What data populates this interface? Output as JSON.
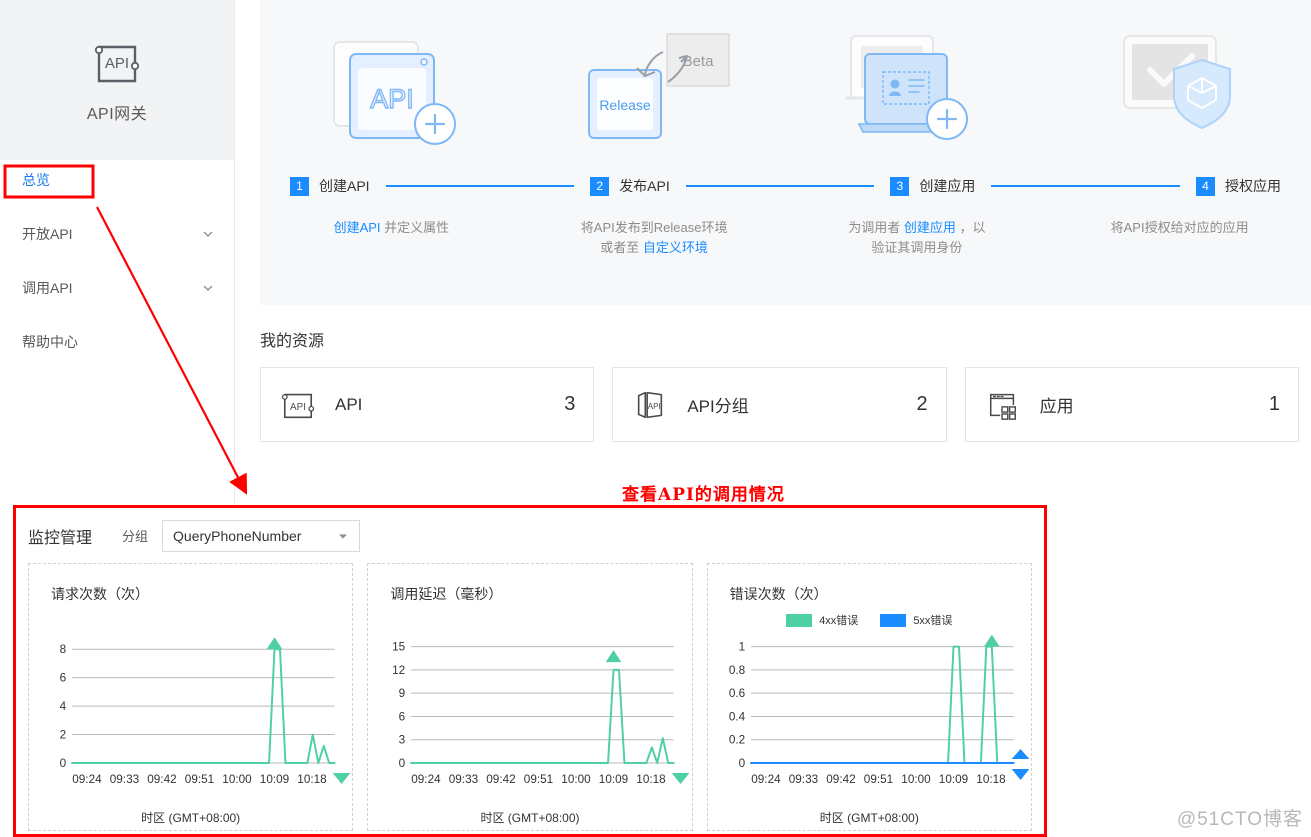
{
  "sidebar": {
    "logo": {
      "icon": "api-gateway-icon",
      "label": "API网关"
    },
    "items": [
      {
        "label": "总览",
        "active": true,
        "expandable": false
      },
      {
        "label": "开放API",
        "active": false,
        "expandable": true
      },
      {
        "label": "调用API",
        "active": false,
        "expandable": true
      },
      {
        "label": "帮助中心",
        "active": false,
        "expandable": false
      }
    ]
  },
  "workflow": {
    "illustrations": [
      "api-create-illustration",
      "release-beta-illustration",
      "app-create-illustration",
      "authorize-shield-illustration"
    ],
    "beta_label": "Beta",
    "release_label": "Release",
    "api_label": "API",
    "steps": [
      {
        "num": "1",
        "label": "创建API"
      },
      {
        "num": "2",
        "label": "发布API"
      },
      {
        "num": "3",
        "label": "创建应用"
      },
      {
        "num": "4",
        "label": "授权应用"
      }
    ],
    "descriptions": [
      {
        "parts": [
          {
            "t": "创建API",
            "link": true
          },
          {
            "t": " 并定义属性",
            "link": false
          }
        ]
      },
      {
        "parts": [
          {
            "t": "将API发布到Release环境",
            "link": false
          },
          {
            "t": "\n",
            "link": false
          },
          {
            "t": "或者至 ",
            "link": false
          },
          {
            "t": "自定义环境",
            "link": true
          }
        ]
      },
      {
        "parts": [
          {
            "t": "为调用者 ",
            "link": false
          },
          {
            "t": "创建应用",
            "link": true
          },
          {
            "t": " ，以",
            "link": false
          },
          {
            "t": "\n",
            "link": false
          },
          {
            "t": "验证其调用身份",
            "link": false
          }
        ]
      },
      {
        "parts": [
          {
            "t": "将API授权给对应的应用",
            "link": false
          }
        ]
      }
    ]
  },
  "resources": {
    "title": "我的资源",
    "cards": [
      {
        "icon": "api-icon",
        "name": "API",
        "count": "3"
      },
      {
        "icon": "api-group-icon",
        "name": "API分组",
        "count": "2"
      },
      {
        "icon": "application-icon",
        "name": "应用",
        "count": "1"
      }
    ]
  },
  "monitor": {
    "title": "监控管理",
    "group_label": "分组",
    "group_selected": "QueryPhoneNumber",
    "timezone_label": "时区 (GMT+08:00)",
    "colors": {
      "series_green": "#4ecfa4",
      "series_blue": "#1a8cff",
      "accent": "#1a8cff",
      "annotation_red": "#ff0000"
    }
  },
  "annotation": {
    "callout_text": "查看API的调用情况",
    "highlight_target": "总览",
    "watermark": "@51CTO博客"
  },
  "chart_data": [
    {
      "type": "line",
      "title": "请求次数（次）",
      "xlabel": "时区 (GMT+08:00)",
      "ylabel": "",
      "ylim": [
        0,
        9
      ],
      "yticks": [
        0,
        2,
        4,
        6,
        8
      ],
      "grid": true,
      "x_ticklabels": [
        "09:24",
        "09:33",
        "09:42",
        "09:51",
        "10:00",
        "10:09",
        "10:18"
      ],
      "series": [
        {
          "name": "请求次数",
          "color": "#4ecfa4",
          "x": [
            0,
            1,
            2,
            3,
            4,
            5,
            6,
            7,
            8,
            9,
            10,
            11,
            12,
            13,
            14,
            15,
            16,
            17,
            18,
            19,
            20,
            21,
            22,
            23,
            24,
            25,
            26,
            27,
            28,
            29,
            30,
            31,
            32,
            33,
            34,
            35,
            36,
            37,
            38,
            39,
            40,
            41,
            42,
            43,
            44,
            45,
            46,
            47,
            48
          ],
          "values": [
            0,
            0,
            0,
            0,
            0,
            0,
            0,
            0,
            0,
            0,
            0,
            0,
            0,
            0,
            0,
            0,
            0,
            0,
            0,
            0,
            0,
            0,
            0,
            0,
            0,
            0,
            0,
            0,
            0,
            0,
            0,
            0,
            0,
            0,
            0,
            0,
            0,
            8,
            8,
            0,
            0,
            0,
            0,
            0,
            2,
            0,
            1.2,
            0,
            0
          ]
        }
      ],
      "marker": {
        "type": "triangle-up",
        "color": "#4ecfa4",
        "at_x_index": 37,
        "at_y": 8
      }
    },
    {
      "type": "line",
      "title": "调用延迟（毫秒）",
      "xlabel": "时区 (GMT+08:00)",
      "ylabel": "",
      "ylim": [
        0,
        16.5
      ],
      "yticks": [
        0,
        3,
        6,
        9,
        12,
        15
      ],
      "grid": true,
      "x_ticklabels": [
        "09:24",
        "09:33",
        "09:42",
        "09:51",
        "10:00",
        "10:09",
        "10:18"
      ],
      "series": [
        {
          "name": "调用延迟",
          "color": "#4ecfa4",
          "x": [
            0,
            1,
            2,
            3,
            4,
            5,
            6,
            7,
            8,
            9,
            10,
            11,
            12,
            13,
            14,
            15,
            16,
            17,
            18,
            19,
            20,
            21,
            22,
            23,
            24,
            25,
            26,
            27,
            28,
            29,
            30,
            31,
            32,
            33,
            34,
            35,
            36,
            37,
            38,
            39,
            40,
            41,
            42,
            43,
            44,
            45,
            46,
            47,
            48
          ],
          "values": [
            0,
            0,
            0,
            0,
            0,
            0,
            0,
            0,
            0,
            0,
            0,
            0,
            0,
            0,
            0,
            0,
            0,
            0,
            0,
            0,
            0,
            0,
            0,
            0,
            0,
            0,
            0,
            0,
            0,
            0,
            0,
            0,
            0,
            0,
            0,
            0,
            0,
            12,
            12,
            0,
            0,
            0,
            0,
            0,
            2,
            0,
            3.2,
            0,
            0
          ]
        }
      ],
      "marker": {
        "type": "triangle-up",
        "color": "#4ecfa4",
        "at_x_index": 37,
        "at_y": 13
      }
    },
    {
      "type": "line",
      "title": "错误次数（次）",
      "xlabel": "时区 (GMT+08:00)",
      "ylabel": "",
      "ylim": [
        0,
        1.1
      ],
      "yticks": [
        0,
        0.2,
        0.4,
        0.6,
        0.8,
        1
      ],
      "grid": true,
      "x_ticklabels": [
        "09:24",
        "09:33",
        "09:42",
        "09:51",
        "10:00",
        "10:09",
        "10:18"
      ],
      "legend": [
        {
          "label": "4xx错误",
          "color": "#4ecfa4"
        },
        {
          "label": "5xx错误",
          "color": "#1a8cff"
        }
      ],
      "series": [
        {
          "name": "4xx错误",
          "color": "#4ecfa4",
          "x": [
            0,
            1,
            2,
            3,
            4,
            5,
            6,
            7,
            8,
            9,
            10,
            11,
            12,
            13,
            14,
            15,
            16,
            17,
            18,
            19,
            20,
            21,
            22,
            23,
            24,
            25,
            26,
            27,
            28,
            29,
            30,
            31,
            32,
            33,
            34,
            35,
            36,
            37,
            38,
            39,
            40,
            41,
            42,
            43,
            44,
            45,
            46,
            47,
            48
          ],
          "values": [
            0,
            0,
            0,
            0,
            0,
            0,
            0,
            0,
            0,
            0,
            0,
            0,
            0,
            0,
            0,
            0,
            0,
            0,
            0,
            0,
            0,
            0,
            0,
            0,
            0,
            0,
            0,
            0,
            0,
            0,
            0,
            0,
            0,
            0,
            0,
            0,
            0,
            1,
            1,
            0,
            0,
            0,
            0,
            1,
            1,
            0,
            0,
            0,
            0
          ]
        },
        {
          "name": "5xx错误",
          "color": "#1a8cff",
          "x": [
            0,
            1,
            2,
            3,
            4,
            5,
            6,
            7,
            8,
            9,
            10,
            11,
            12,
            13,
            14,
            15,
            16,
            17,
            18,
            19,
            20,
            21,
            22,
            23,
            24,
            25,
            26,
            27,
            28,
            29,
            30,
            31,
            32,
            33,
            34,
            35,
            36,
            37,
            38,
            39,
            40,
            41,
            42,
            43,
            44,
            45,
            46,
            47,
            48
          ],
          "values": [
            0,
            0,
            0,
            0,
            0,
            0,
            0,
            0,
            0,
            0,
            0,
            0,
            0,
            0,
            0,
            0,
            0,
            0,
            0,
            0,
            0,
            0,
            0,
            0,
            0,
            0,
            0,
            0,
            0,
            0,
            0,
            0,
            0,
            0,
            0,
            0,
            0,
            0,
            0,
            0,
            0,
            0,
            0,
            0,
            0,
            0,
            0,
            0,
            0
          ]
        }
      ],
      "marker": {
        "type": "triangle-up",
        "color": "#4ecfa4",
        "at_x_index": 44,
        "at_y": 1
      }
    }
  ]
}
